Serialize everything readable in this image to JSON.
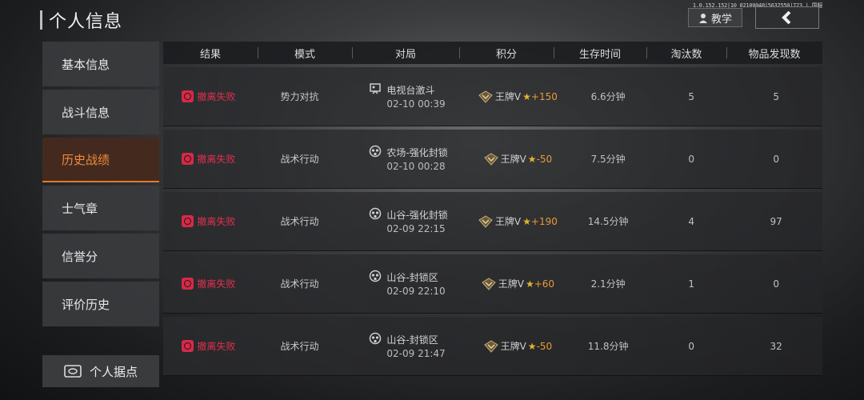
{
  "watermark": "1.0.152.152|10 02100048|5632550|723 | 国服",
  "header": {
    "title": "个人信息",
    "tutorial_label": "教学"
  },
  "sidebar": {
    "items": [
      {
        "label": "基本信息",
        "active": false
      },
      {
        "label": "战斗信息",
        "active": false
      },
      {
        "label": "历史战绩",
        "active": true
      },
      {
        "label": "士气章",
        "active": false
      },
      {
        "label": "信誉分",
        "active": false
      },
      {
        "label": "评价历史",
        "active": false
      }
    ],
    "base_button": "个人据点"
  },
  "table": {
    "columns": [
      "结果",
      "模式",
      "对局",
      "积分",
      "生存时间",
      "淘汰数",
      "物品发现数"
    ],
    "rows": [
      {
        "result": "撤离失败",
        "mode": "势力对抗",
        "map": "电视台激斗",
        "time": "02-10 00:39",
        "map_icon": "tv-tower-icon",
        "rank": "王牌V",
        "delta": "+150",
        "survival": "6.6分钟",
        "kills": "5",
        "items": "5"
      },
      {
        "result": "撤离失败",
        "mode": "战术行动",
        "map": "农场-强化封锁",
        "time": "02-10 00:28",
        "map_icon": "gasmask-icon",
        "rank": "王牌V",
        "delta": "-50",
        "survival": "7.5分钟",
        "kills": "0",
        "items": "0"
      },
      {
        "result": "撤离失败",
        "mode": "战术行动",
        "map": "山谷-强化封锁",
        "time": "02-09 22:15",
        "map_icon": "gasmask-icon",
        "rank": "王牌V",
        "delta": "+190",
        "survival": "14.5分钟",
        "kills": "4",
        "items": "97"
      },
      {
        "result": "撤离失败",
        "mode": "战术行动",
        "map": "山谷-封锁区",
        "time": "02-09 22:10",
        "map_icon": "gasmask-icon",
        "rank": "王牌V",
        "delta": "+60",
        "survival": "2.1分钟",
        "kills": "1",
        "items": "0"
      },
      {
        "result": "撤离失败",
        "mode": "战术行动",
        "map": "山谷-封锁区",
        "time": "02-09 21:47",
        "map_icon": "gasmask-icon",
        "rank": "王牌V",
        "delta": "-50",
        "survival": "11.8分钟",
        "kills": "0",
        "items": "32"
      }
    ]
  },
  "colors": {
    "accent": "#e07a2f",
    "fail": "#e0304f",
    "star": "#e2b430"
  }
}
